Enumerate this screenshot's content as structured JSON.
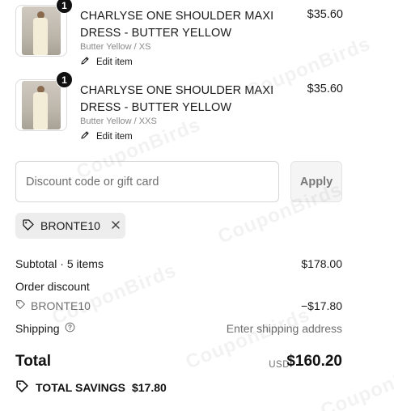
{
  "line_items": [
    {
      "quantity": "1",
      "title": "CHARLYSE ONE SHOULDER MAXI DRESS - BUTTER YELLOW",
      "variant": "Butter Yellow / XS",
      "edit_label": "Edit item",
      "price": "$35.60"
    },
    {
      "quantity": "1",
      "title": "CHARLYSE ONE SHOULDER MAXI DRESS - BUTTER YELLOW",
      "variant": "Butter Yellow / XXS",
      "edit_label": "Edit item",
      "price": "$35.60"
    }
  ],
  "discount": {
    "placeholder": "Discount code or gift card",
    "value": "",
    "apply_label": "Apply",
    "applied_code": "BRONTE10"
  },
  "summary": {
    "subtotal_label": "Subtotal · 5 items",
    "subtotal_value": "$178.00",
    "order_discount_label": "Order discount",
    "discount_code": "BRONTE10",
    "discount_value": "−$17.80",
    "shipping_label": "Shipping",
    "shipping_value": "Enter shipping address",
    "total_label": "Total",
    "currency": "USD",
    "total_value": "$160.20",
    "savings_label": "TOTAL SAVINGS",
    "savings_value": "$17.80"
  },
  "watermark": "CouponBirds",
  "colors": {
    "text": "#1a1a1a",
    "muted": "#6f6f6f",
    "badge": "#111111",
    "chip_bg": "#ededed",
    "apply_bg": "#f5f5f5"
  },
  "icons": {
    "edit": "pencil-icon",
    "tag": "tag-icon",
    "close": "close-icon",
    "help": "question-circle-icon"
  }
}
